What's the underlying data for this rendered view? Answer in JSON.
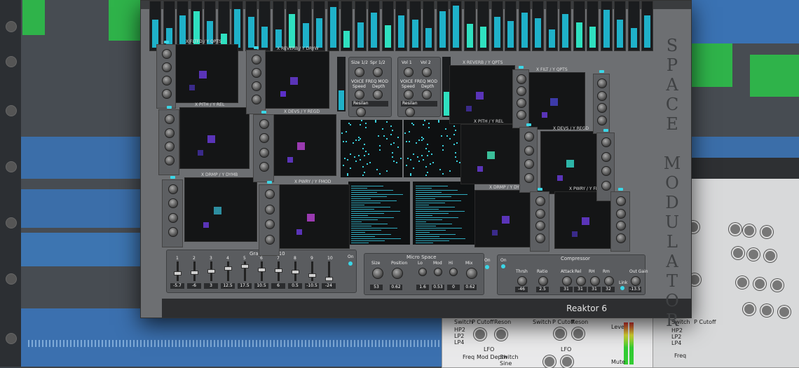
{
  "plugin": {
    "title": "SPACE MODULATOR",
    "footer": "Reaktor 6"
  },
  "xy_pads": [
    {
      "label": "X FLTFD / Y QPTS",
      "sq_color": "#5a34b8",
      "sq_color2": "#3a2a8a"
    },
    {
      "label": "X REVERB / Y DRYW",
      "sq_color": "#5a34b8",
      "sq_color2": "#5b2fc9"
    },
    {
      "label": "X REVERB / Y QPTS",
      "sq_color": "#5a34b8",
      "sq_color2": "#3a2a8a"
    },
    {
      "label": "X FILT / Y QPTS",
      "sq_color": "#3c3aa8",
      "sq_color2": "#5a34b8"
    },
    {
      "label": "X PITH / Y REL",
      "sq_color": "#5a34b8",
      "sq_color2": "#3a2a8a"
    },
    {
      "label": "X DEVS / Y REGD",
      "sq_color": "#9a3ab0",
      "sq_color2": "#5a34b8"
    },
    {
      "label": "X PITH / Y REL",
      "sq_color": "#3bbf9a",
      "sq_color2": "#5a34b8"
    },
    {
      "label": "X DEVS / Y REGD",
      "sq_color": "#2db5a8",
      "sq_color2": "#5a34b8"
    },
    {
      "label": "X DRMP / Y DYMB",
      "sq_color": "#2d8ea0",
      "sq_color2": "#5a34b8"
    },
    {
      "label": "X PWRY / Y FMOD",
      "sq_color": "#9a3ab0",
      "sq_color2": "#5a34b8"
    },
    {
      "label": "X DRMP / Y DYMB",
      "sq_color": "#5a34b8",
      "sq_color2": "#3a2a8a"
    },
    {
      "label": "X PWRY / Y FMOD",
      "sq_color": "#5a34b8",
      "sq_color2": "#3a2a8a"
    }
  ],
  "center_modules": {
    "a_labels": [
      "Size 1/2",
      "Spr 1/2"
    ],
    "b_labels": [
      "Vol 1",
      "Vol 2"
    ],
    "voice_label": "VOICE FREQ MOD",
    "speed": "Speed",
    "depth": "Depth",
    "mode_a": "Resilan",
    "mode_b": "Resilan"
  },
  "eq": {
    "title": "Graphic EQ 10",
    "bands": [
      "1",
      "2",
      "3",
      "4",
      "5",
      "6",
      "7",
      "8",
      "9",
      "10"
    ],
    "values": [
      "-5.7",
      "-6",
      "3",
      "12.5",
      "17.5",
      "10.5",
      "6",
      "0.5",
      "-10.5",
      "-24"
    ],
    "levels": [
      0.42,
      0.45,
      0.55,
      0.7,
      0.82,
      0.62,
      0.58,
      0.5,
      0.3,
      0.1
    ],
    "on_label": "On"
  },
  "micro_space": {
    "title": "Micro Space",
    "knobs": [
      {
        "label": "Size",
        "value": "53"
      },
      {
        "label": "Position",
        "value": "0.62"
      },
      {
        "label": "Lo",
        "value": "1.6"
      },
      {
        "label": "Mod",
        "value": "0.53"
      },
      {
        "label": "Hi",
        "value": "0"
      },
      {
        "label": "Mix",
        "value": "0.62"
      }
    ],
    "on_label": "On"
  },
  "compressor": {
    "title": "Compressor",
    "on_label": "On",
    "knobs": [
      {
        "label": "Thrsh",
        "value": "-46"
      },
      {
        "label": "Ratio",
        "value": "2.5"
      },
      {
        "label": "Attack",
        "value": "31"
      },
      {
        "label": "Rel",
        "value": "31"
      },
      {
        "label": "RH",
        "value": "31"
      },
      {
        "label": "Rm",
        "value": "32"
      },
      {
        "label": "Out Gain",
        "value": "-13.5"
      }
    ],
    "link_label": "Link"
  },
  "background_synth": {
    "labels": [
      "Switch",
      "P Cutoff",
      "Reson",
      "HP2",
      "LP2",
      "LP4",
      "LFO",
      "Freq",
      "Mod Depth",
      "Switch",
      "Sine"
    ],
    "level_label": "Level",
    "mute_label": "Mute"
  },
  "colors": {
    "accent": "#1fb1c9",
    "teal": "#2fe0c0",
    "track_blue": "#3a74b8",
    "green": "#2fb34a"
  }
}
